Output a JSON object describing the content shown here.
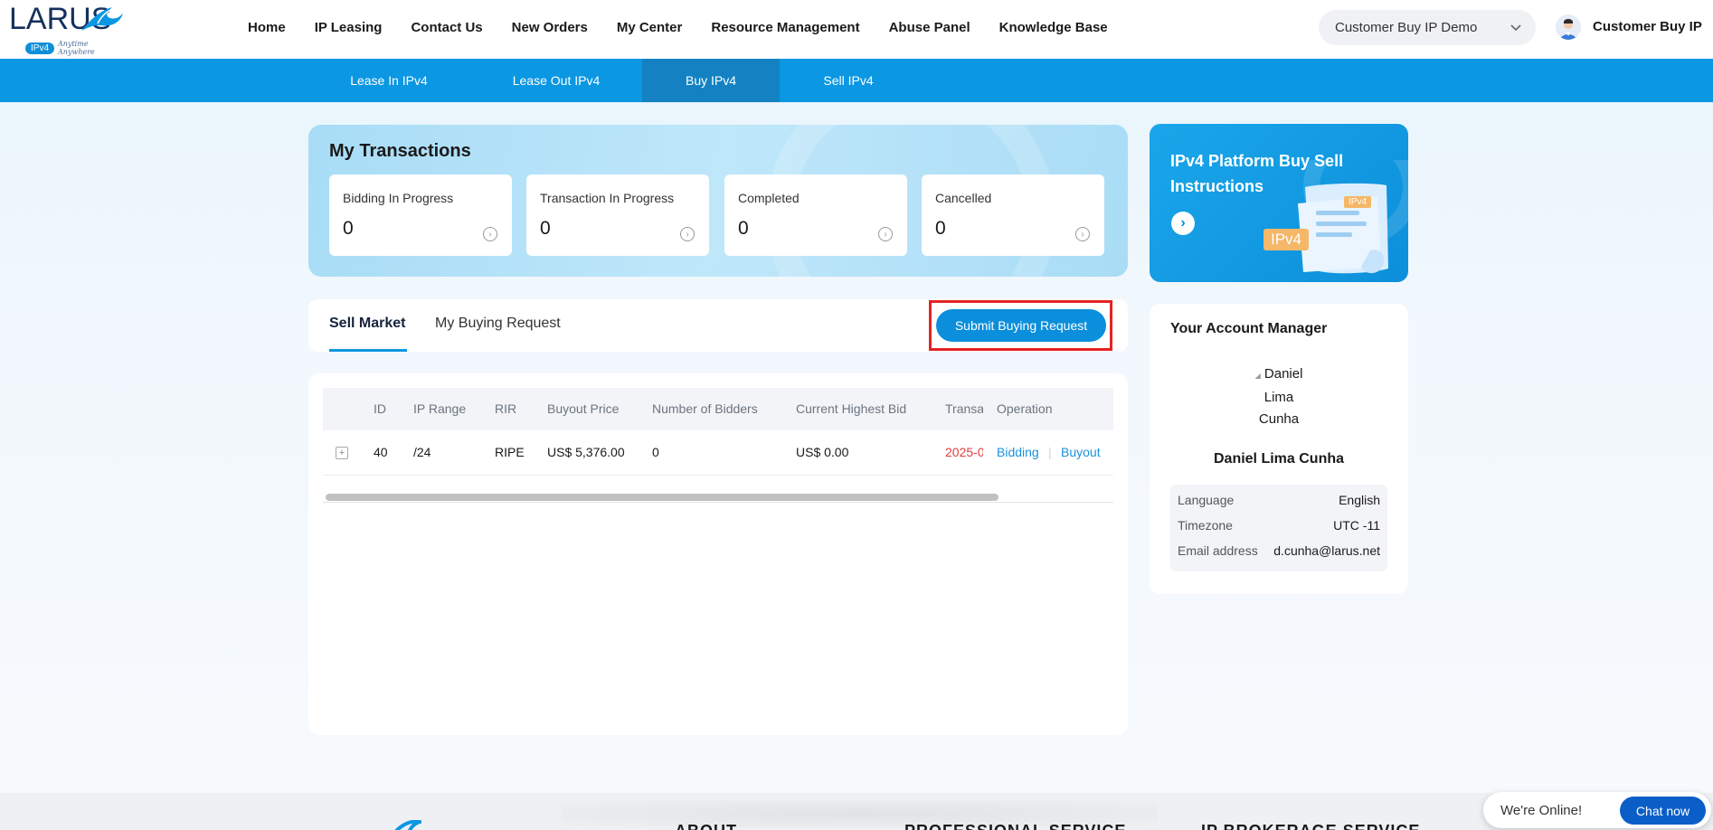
{
  "brand": {
    "logo_text": "LARUS",
    "logo_badge": "IPv4",
    "logo_slogan": "Anytime Anywhere",
    "accent": "#0b97e2"
  },
  "header": {
    "nav": [
      "Home",
      "IP Leasing",
      "Contact Us",
      "New Orders",
      "My Center",
      "Resource Management",
      "Abuse Panel",
      "Knowledge Base"
    ],
    "account_select": "Customer Buy IP Demo",
    "user_name": "Customer Buy IP"
  },
  "subnav": {
    "items": [
      "Lease In IPv4",
      "Lease Out IPv4",
      "Buy IPv4",
      "Sell IPv4"
    ],
    "active": "Buy IPv4"
  },
  "transactions": {
    "title": "My Transactions",
    "stats": [
      {
        "label": "Bidding In Progress",
        "value": "0"
      },
      {
        "label": "Transaction In Progress",
        "value": "0"
      },
      {
        "label": "Completed",
        "value": "0"
      },
      {
        "label": "Cancelled",
        "value": "0"
      }
    ]
  },
  "market": {
    "tabs": [
      "Sell Market",
      "My Buying Request"
    ],
    "active_tab": "Sell Market",
    "submit_label": "Submit Buying Request"
  },
  "table": {
    "columns": [
      "ID",
      "IP Range",
      "RIR",
      "Buyout Price",
      "Number of Bidders",
      "Current Highest Bid",
      "Transa",
      "Operation"
    ],
    "rows": [
      {
        "id": "40",
        "ip_range": "/24",
        "rir": "RIPE",
        "buyout_price": "US$ 5,376.00",
        "bidders": "0",
        "highest_bid": "US$ 0.00",
        "transaction_date": "2025-0",
        "op_bid": "Bidding",
        "op_buyout": "Buyout",
        "op_sep": "|"
      }
    ]
  },
  "promo": {
    "title": "IPv4 Platform Buy Sell Instructions",
    "badge_large": "IPv4",
    "badge_small": "IPv4"
  },
  "manager": {
    "title": "Your Account Manager",
    "photo_alt_lines": [
      "Daniel",
      "Lima",
      "Cunha"
    ],
    "name": "Daniel Lima Cunha",
    "info": [
      {
        "key": "Language",
        "value": "English"
      },
      {
        "key": "Timezone",
        "value": "UTC -11"
      },
      {
        "key": "Email address",
        "value": "d.cunha@larus.net"
      }
    ]
  },
  "footer": {
    "columns": [
      "ABOUT",
      "PROFESSIONAL SERVICE",
      "IP BROKERAGE SERVICE"
    ]
  },
  "chat": {
    "status": "We're Online!",
    "button": "Chat now"
  }
}
